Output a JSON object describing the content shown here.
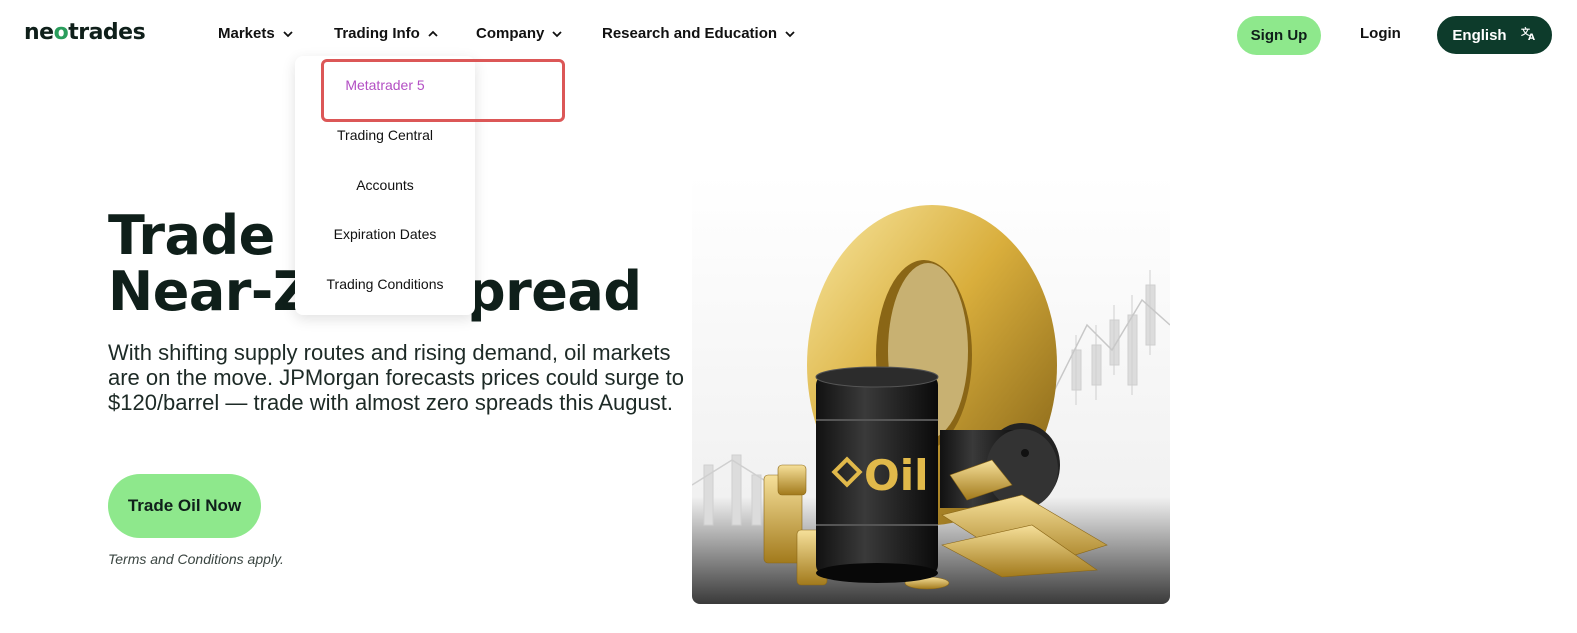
{
  "nav": {
    "logo": "neotrades",
    "items": [
      {
        "label": "Markets",
        "icon": "chevron-down-icon"
      },
      {
        "label": "Trading Info",
        "icon": "chevron-up-icon"
      },
      {
        "label": "Company",
        "icon": "chevron-down-icon"
      },
      {
        "label": "Research and Education",
        "icon": "chevron-down-icon"
      }
    ],
    "signup_label": "Sign Up",
    "login_label": "Login",
    "language_label": "English",
    "language_icon": "translate-icon"
  },
  "dropdown": {
    "items": [
      {
        "label": "Metatrader 5",
        "active": true
      },
      {
        "label": "Trading Central"
      },
      {
        "label": "Accounts"
      },
      {
        "label": "Expiration Dates"
      },
      {
        "label": "Trading Conditions"
      }
    ]
  },
  "hero": {
    "title_line1": "Trade Oil at",
    "title_line2": "Near-Zero Spread",
    "description": "With shifting supply routes and rising demand, oil markets are on the move. JPMorgan forecasts prices could surge to $120/barrel — trade with almost zero spreads this August.",
    "cta_label": "Trade Oil Now",
    "terms": "Terms and Conditions apply.",
    "image_barrel_text": "Oil"
  },
  "colors": {
    "accent_green": "#8ee88c",
    "dark_green": "#0d3b2b",
    "active_purple": "#b34fc4",
    "highlight_red": "#dc5757"
  }
}
